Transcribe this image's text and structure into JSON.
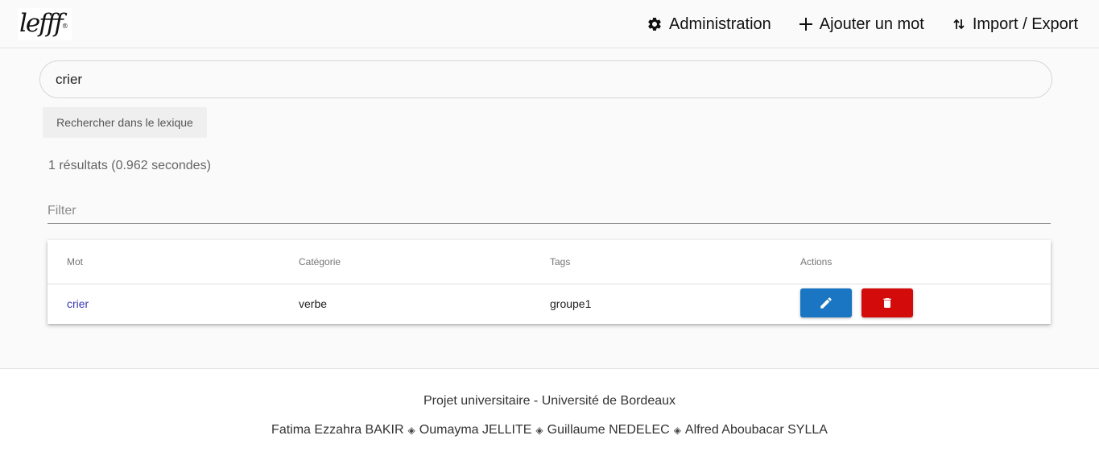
{
  "header": {
    "logo_text": "lefff",
    "nav": [
      {
        "label": "Administration",
        "icon": "gear-icon"
      },
      {
        "label": "Ajouter un mot",
        "icon": "plus-icon"
      },
      {
        "label": "Import / Export",
        "icon": "swap-vertical-icon"
      }
    ]
  },
  "search": {
    "value": "crier",
    "button_label": "Rechercher dans le lexique"
  },
  "results": {
    "count_text": "1 résultats (0.962 secondes)"
  },
  "filter": {
    "placeholder": "Filter"
  },
  "table": {
    "headers": [
      "Mot",
      "Catégorie",
      "Tags",
      "Actions"
    ],
    "rows": [
      {
        "mot": "crier",
        "categorie": "verbe",
        "tags": "groupe1"
      }
    ]
  },
  "colors": {
    "edit_button": "#1a76c2",
    "delete_button": "#d40b0b",
    "link": "#3a3ab8"
  },
  "footer": {
    "line1": "Projet universitaire - Université de Bordeaux",
    "authors": [
      "Fatima Ezzahra BAKIR",
      "Oumayma JELLITE",
      "Guillaume NEDELEC",
      "Alfred Aboubacar SYLLA"
    ],
    "separator": "◈"
  }
}
